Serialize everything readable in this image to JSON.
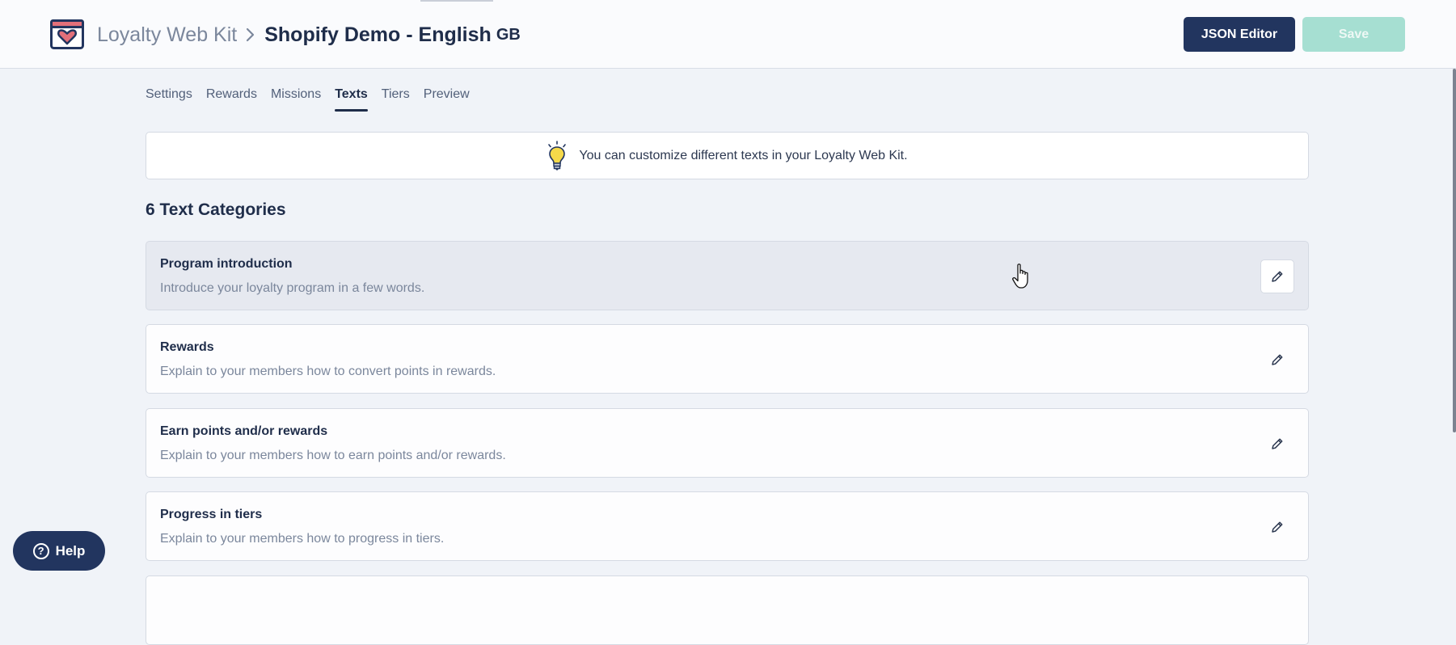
{
  "header": {
    "app_name": "Loyalty Web Kit",
    "breadcrumb_sep_icon": "chevron-right-icon",
    "current_page": "Shopify Demo - English",
    "locale": "GB",
    "json_editor_label": "JSON Editor",
    "save_label": "Save"
  },
  "tabs": [
    {
      "label": "Settings",
      "active": false
    },
    {
      "label": "Rewards",
      "active": false
    },
    {
      "label": "Missions",
      "active": false
    },
    {
      "label": "Texts",
      "active": true
    },
    {
      "label": "Tiers",
      "active": false
    },
    {
      "label": "Preview",
      "active": false
    }
  ],
  "info_banner": {
    "icon": "lightbulb-icon",
    "text": "You can customize different texts in your Loyalty Web Kit."
  },
  "section_title": "6 Text Categories",
  "categories": [
    {
      "title": "Program introduction",
      "description": "Introduce your loyalty program in a few words."
    },
    {
      "title": "Rewards",
      "description": "Explain to your members how to convert points in rewards."
    },
    {
      "title": "Earn points and/or rewards",
      "description": "Explain to your members how to earn points and/or rewards."
    },
    {
      "title": "Progress in tiers",
      "description": "Explain to your members how to progress in tiers."
    }
  ],
  "help": {
    "label": "Help",
    "icon_glyph": "?"
  },
  "colors": {
    "primary": "#22355f",
    "save_disabled": "#a6dfd2",
    "background": "#f0f3f8",
    "logo_accent": "#e3707a"
  }
}
